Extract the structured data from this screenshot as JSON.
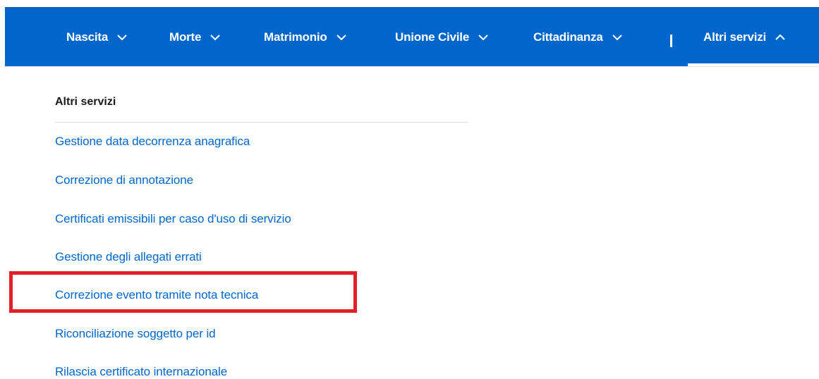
{
  "nav": {
    "items": [
      {
        "label": "Nascita",
        "expanded": false
      },
      {
        "label": "Morte",
        "expanded": false
      },
      {
        "label": "Matrimonio",
        "expanded": false
      },
      {
        "label": "Unione Civile",
        "expanded": false
      },
      {
        "label": "Cittadinanza",
        "expanded": false
      }
    ],
    "active": {
      "label": "Altri servizi",
      "expanded": true
    },
    "brand_color": "#0066cc"
  },
  "menu": {
    "heading": "Altri servizi",
    "links": [
      "Gestione data decorrenza anagrafica",
      "Correzione di annotazione",
      "Certificati emissibili per caso d'uso di servizio",
      "Gestione degli allegati errati",
      "Correzione evento tramite nota tecnica",
      "Riconciliazione soggetto per id",
      "Rilascia certificato internazionale"
    ],
    "highlighted_index": 4,
    "highlight_color": "#e3202a",
    "link_color": "#0066cc"
  }
}
